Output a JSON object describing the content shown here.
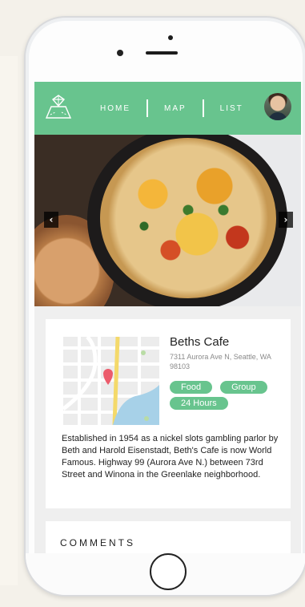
{
  "nav": {
    "items": [
      {
        "label": "HOME"
      },
      {
        "label": "MAP"
      },
      {
        "label": "LIST"
      }
    ],
    "logo_icon": "diamond-map-icon",
    "avatar_icon": "user-avatar"
  },
  "hero": {
    "prev_arrow": "‹",
    "next_arrow": "›",
    "image": "skillet-egg-dish-photo"
  },
  "place": {
    "name": "Beths Cafe",
    "address": "7311 Aurora Ave N, Seattle, WA 98103",
    "tags": [
      "Food",
      "Group",
      "24 Hours"
    ],
    "description": "Established in 1954 as a nickel slots gambling parlor by Beth and Harold Eisenstadt, Beth's Cafe is now World Famous. Highway 99 (Aurora Ave N.) between 73rd Street and Winona in the Greenlake neighborhood."
  },
  "comments": {
    "title": "COMMENTS"
  },
  "colors": {
    "accent": "#68c48e",
    "background": "#efefef"
  }
}
